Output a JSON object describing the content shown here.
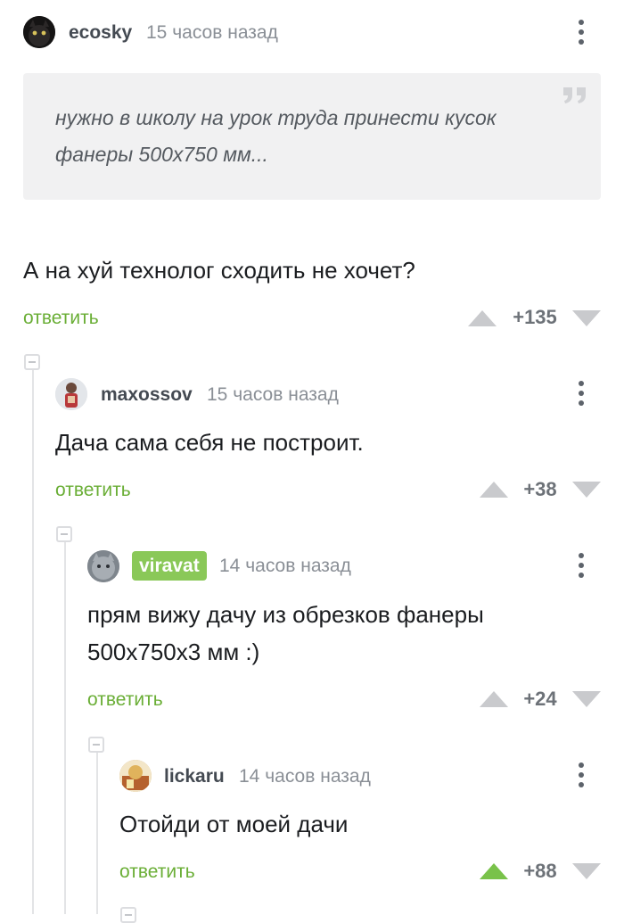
{
  "top": {
    "author": "ecosky",
    "time": "15 часов назад",
    "quote": "нужно в школу на урок труда принести кусок фанеры 500х750 мм...",
    "text": "А на хуй технолог сходить не хочет?",
    "reply_label": "ответить",
    "rating": "+135",
    "vote_state": "none"
  },
  "replies": [
    {
      "author": "maxossov",
      "time": "15 часов назад",
      "text": "Дача сама себя не построит.",
      "reply_label": "ответить",
      "rating": "+38",
      "vote_state": "none"
    },
    {
      "author": "viravat",
      "author_badge": true,
      "time": "14 часов назад",
      "text_line1": "прям вижу дачу из обрезков фанеры",
      "text_line2": "500х750х3 мм :)",
      "reply_label": "ответить",
      "rating": "+24",
      "vote_state": "none"
    },
    {
      "author": "lickaru",
      "time": "14 часов назад",
      "text": "Отойди от моей дачи",
      "reply_label": "ответить",
      "rating": "+88",
      "vote_state": "up"
    }
  ],
  "colors": {
    "accent_green": "#6aae36",
    "vote_active": "#79c24a",
    "vote_inactive": "#c9cacd",
    "badge_green": "#8ac858"
  },
  "icons": [
    "more-vertical-icon",
    "quote-icon",
    "vote-up-icon",
    "vote-down-icon",
    "collapse-thread-icon"
  ]
}
